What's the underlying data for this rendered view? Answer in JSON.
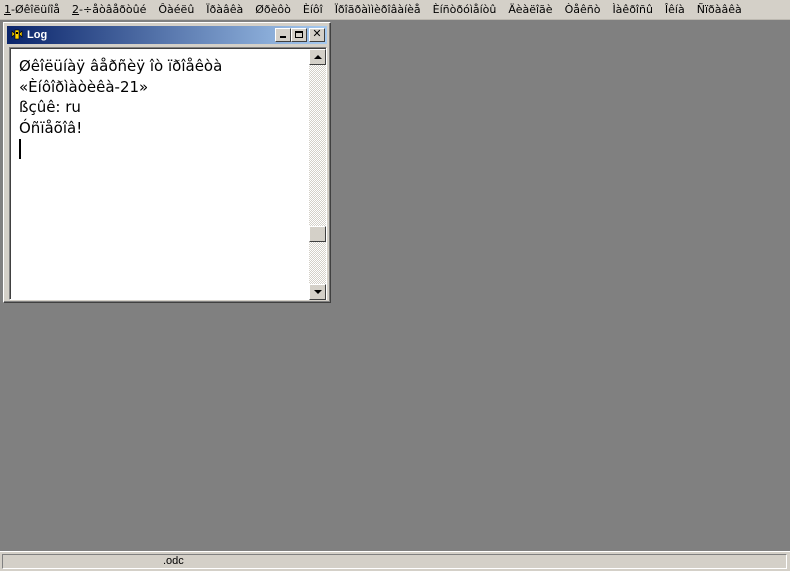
{
  "menubar": {
    "items": [
      {
        "accel": "1",
        "rest": "-Øêîëüíîå"
      },
      {
        "accel": "2",
        "rest": "-÷åòâåðòûé"
      },
      {
        "accel": "",
        "rest": "Ôàéëû"
      },
      {
        "accel": "",
        "rest": "Ïðàâêà"
      },
      {
        "accel": "",
        "rest": "Øðèôò"
      },
      {
        "accel": "",
        "rest": "Èíôî"
      },
      {
        "accel": "",
        "rest": "Ïðîãðàììèðîâàíèå"
      },
      {
        "accel": "",
        "rest": "Èíñòðóìåíòû"
      },
      {
        "accel": "",
        "rest": "Äèàëîãè"
      },
      {
        "accel": "",
        "rest": "Òåêñò"
      },
      {
        "accel": "",
        "rest": "Ìàêðîñû"
      },
      {
        "accel": "",
        "rest": "Îêíà"
      },
      {
        "accel": "",
        "rest": "Ñïðàâêà"
      }
    ]
  },
  "log_window": {
    "title": "Log",
    "lines": [
      "Øêîëüíàÿ âåðñèÿ îò ïðîåêòà",
      "«Èíôîðìàòèêà-21»",
      "ßçûê: ru",
      "Óñïåõîâ!"
    ]
  },
  "statusbar": {
    "text": ".odc"
  },
  "colors": {
    "desktop": "#808080",
    "chrome": "#d4d0c8",
    "title_start": "#0a246a",
    "title_end": "#a6caf0"
  }
}
